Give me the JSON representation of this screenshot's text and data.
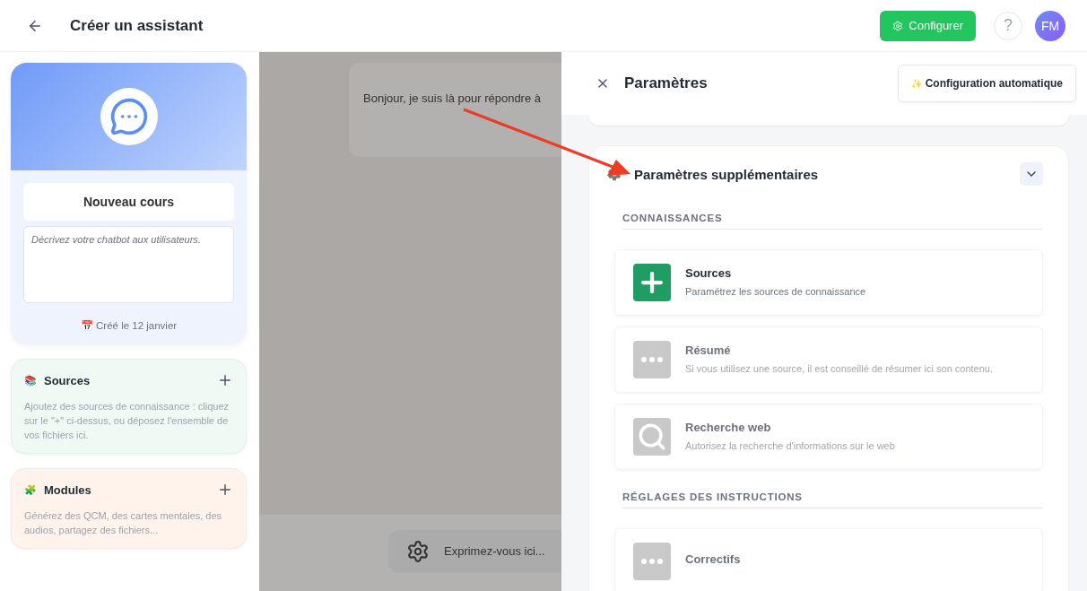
{
  "header": {
    "title": "Créer un assistant",
    "configure_button": "Configurer",
    "help": "?",
    "avatar": "FM"
  },
  "assistant_card": {
    "name": "Nouveau cours",
    "description_placeholder": "Décrivez votre chatbot aux utilisateurs.",
    "created": "📅 Créé le 12 janvier"
  },
  "side_cards": [
    {
      "emoji": "📚",
      "title": "Sources",
      "text": "Ajoutez des sources de connaissance : cliquez sur le \"+\" ci-dessus, ou déposez l'ensemble de vos fichiers ici.",
      "color": "#effaf4"
    },
    {
      "emoji": "🧩",
      "title": "Modules",
      "text": "Générez des QCM, des cartes mentales, des audios, partagez des fichiers...",
      "color": "#fff3ec"
    }
  ],
  "chat": {
    "message": "Bonjour, je suis là pour répondre à",
    "input_placeholder": "Exprimez-vous ici..."
  },
  "settings_panel": {
    "title": "Paramètres",
    "auto_config_button": "Configuration automatique",
    "auto_config_icon": "✨",
    "section": {
      "title": "Paramètres supplémentaires",
      "expanded": true,
      "groups": [
        {
          "heading": "CONNAISSANCES",
          "items": [
            {
              "kind": "plus",
              "title": "Sources",
              "subtitle": "Paramétrez les sources de connaissance",
              "enabled": true
            },
            {
              "kind": "dots",
              "title": "Résumé",
              "subtitle": "Si vous utilisez une source, il est conseillé de résumer ici son contenu.",
              "enabled": false
            },
            {
              "kind": "search",
              "title": "Recherche web",
              "subtitle": "Autorisez la recherche d'informations sur le web",
              "enabled": false
            }
          ]
        },
        {
          "heading": "RÉGLAGES DES INSTRUCTIONS",
          "items": [
            {
              "kind": "dots",
              "title": "Correctifs",
              "enabled": false
            }
          ]
        }
      ]
    }
  }
}
